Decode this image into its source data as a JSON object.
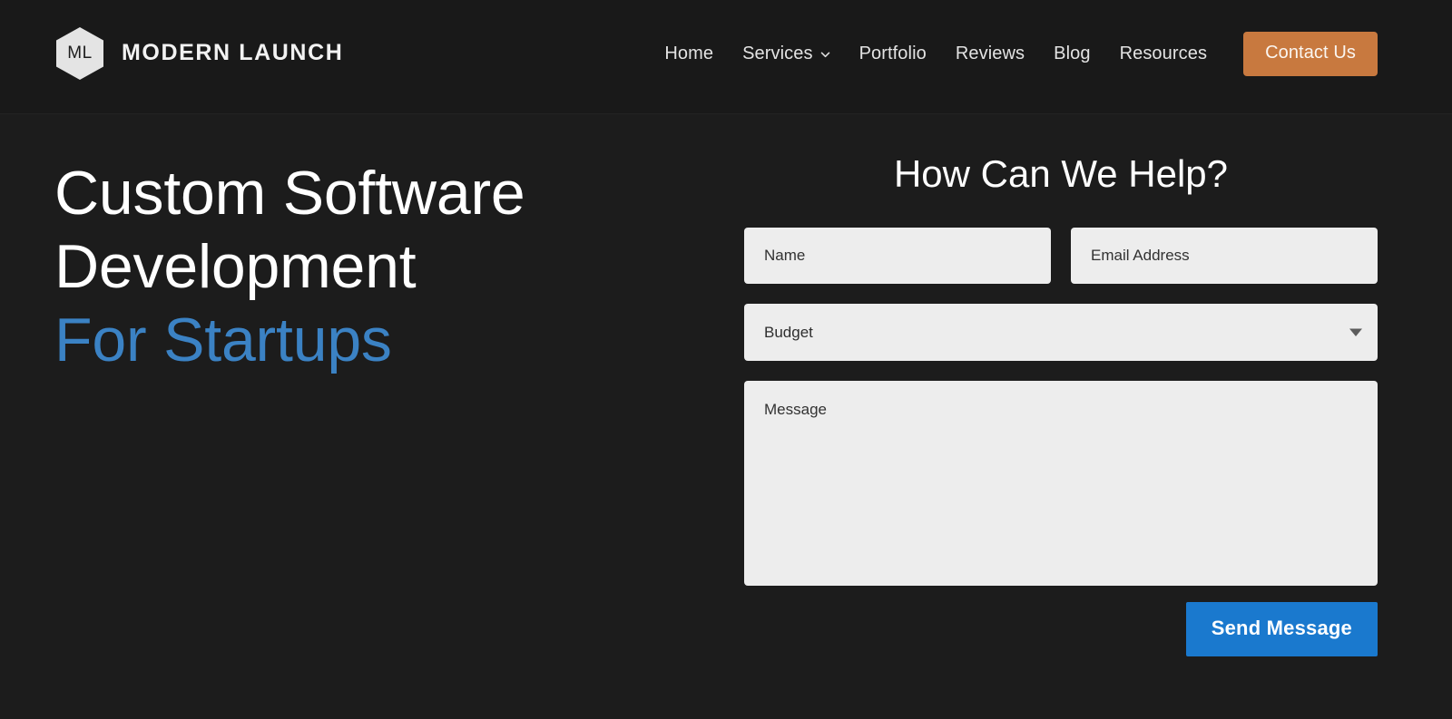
{
  "brand": {
    "logo_mark": "ML",
    "logo_icon": "hexagon-icon",
    "name": "MODERN LAUNCH"
  },
  "nav": {
    "items": [
      {
        "label": "Home",
        "has_caret": false
      },
      {
        "label": "Services",
        "has_caret": true
      },
      {
        "label": "Portfolio",
        "has_caret": false
      },
      {
        "label": "Reviews",
        "has_caret": false
      },
      {
        "label": "Blog",
        "has_caret": false
      },
      {
        "label": "Resources",
        "has_caret": false
      }
    ],
    "cta": {
      "label": "Contact Us",
      "color": "#c8793f"
    }
  },
  "hero": {
    "headline_line1": "Custom Software",
    "headline_line2": "Development",
    "headline_accent": "For Startups",
    "accent_color": "#3b82c4"
  },
  "form": {
    "title": "How Can We Help?",
    "name_placeholder": "Name",
    "email_placeholder": "Email Address",
    "budget_placeholder": "Budget",
    "budget_value": "Budget",
    "message_placeholder": "Message",
    "submit_label": "Send Message",
    "submit_color": "#1a79ce",
    "field_bg": "#ededed"
  },
  "theme": {
    "header_bg": "#191919",
    "body_bg": "#1c1c1c"
  }
}
